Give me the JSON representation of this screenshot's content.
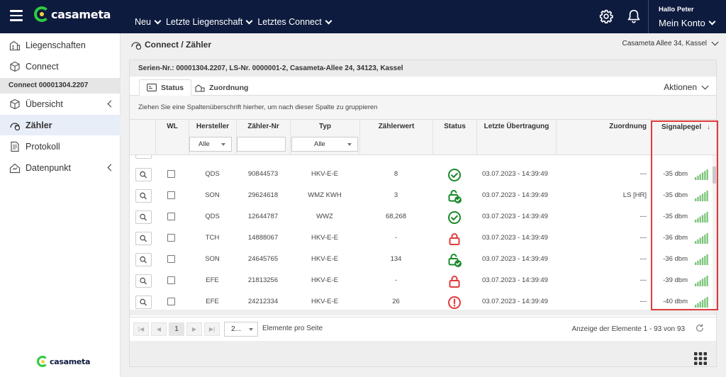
{
  "topbar": {
    "brand": "casameta",
    "nav": [
      {
        "label": "Neu"
      },
      {
        "label": "Letzte Liegenschaft"
      },
      {
        "label": "Letztes Connect"
      }
    ],
    "greeting": "Hallo Peter",
    "account_label": "Mein Konto"
  },
  "sidebar": {
    "items_top": [
      {
        "label": "Liegenschaften",
        "icon": "building-icon"
      },
      {
        "label": "Connect",
        "icon": "box-icon"
      }
    ],
    "section_label": "Connect 00001304.2207",
    "items_sub": [
      {
        "label": "Übersicht",
        "icon": "box-icon",
        "expandable": true
      },
      {
        "label": "Zähler",
        "icon": "meter-icon",
        "active": true
      },
      {
        "label": "Protokoll",
        "icon": "document-icon"
      },
      {
        "label": "Datenpunkt",
        "icon": "datapoint-icon",
        "expandable": true
      }
    ],
    "footer_brand": "casameta"
  },
  "main": {
    "title": "Connect / Zähler",
    "address": "Casameta Allee 34, Kassel",
    "card_header": "Serien-Nr.: 00001304.2207, LS-Nr. 0000001-2, Casameta-Allee 24, 34123, Kassel",
    "tabs": [
      {
        "label": "Status",
        "active": true
      },
      {
        "label": "Zuordnung",
        "active": false
      }
    ],
    "actions_label": "Aktionen",
    "group_hint": "Ziehen Sie eine Spaltenüberschrift hierher, um nach dieser Spalte zu gruppieren"
  },
  "grid": {
    "columns": {
      "wl": "WL",
      "hersteller": "Hersteller",
      "zaehler_nr": "Zähler-Nr",
      "typ": "Typ",
      "zaehlerwert": "Zählerwert",
      "status": "Status",
      "letzte_uebertragung": "Letzte Übertragung",
      "zuordnung": "Zuordnung",
      "signalpegel": "Signalpegel"
    },
    "sort_indicator": "↓",
    "filters": {
      "hersteller": "Alle",
      "typ": "Alle"
    },
    "rows": [
      {
        "hersteller": "QDS",
        "zaehler_nr": "90844573",
        "typ": "HKV-E-E",
        "wert": "8",
        "status": "ok",
        "zeit": "03.07.2023 - 14:39:49",
        "zuordnung": "---",
        "signal": "-35 dbm"
      },
      {
        "hersteller": "SON",
        "zaehler_nr": "29624618",
        "typ": "WMZ KWH",
        "wert": "3",
        "status": "unlocked",
        "zeit": "03.07.2023 - 14:39:49",
        "zuordnung": "LS [HR]",
        "signal": "-35 dbm"
      },
      {
        "hersteller": "QDS",
        "zaehler_nr": "12644787",
        "typ": "WWZ",
        "wert": "68,268",
        "status": "ok",
        "zeit": "03.07.2023 - 14:39:49",
        "zuordnung": "---",
        "signal": "-35 dbm"
      },
      {
        "hersteller": "TCH",
        "zaehler_nr": "14888067",
        "typ": "HKV-E-E",
        "wert": "-",
        "status": "locked",
        "zeit": "03.07.2023 - 14:39:49",
        "zuordnung": "---",
        "signal": "-36 dbm"
      },
      {
        "hersteller": "SON",
        "zaehler_nr": "24645765",
        "typ": "HKV-E-E",
        "wert": "134",
        "status": "unlocked",
        "zeit": "03.07.2023 - 14:39:49",
        "zuordnung": "---",
        "signal": "-36 dbm"
      },
      {
        "hersteller": "EFE",
        "zaehler_nr": "21813256",
        "typ": "HKV-E-E",
        "wert": "-",
        "status": "locked",
        "zeit": "03.07.2023 - 14:39:49",
        "zuordnung": "---",
        "signal": "-39 dbm"
      },
      {
        "hersteller": "EFE",
        "zaehler_nr": "24212334",
        "typ": "HKV-E-E",
        "wert": "26",
        "status": "error",
        "zeit": "03.07.2023 - 14:39:49",
        "zuordnung": "---",
        "signal": "-40 dbm"
      }
    ]
  },
  "pager": {
    "current_page": "1",
    "page_size": "2...",
    "page_size_label": "Elemente pro Seite",
    "info": "Anzeige der Elemente 1 - 93 von 93"
  },
  "colors": {
    "topbar_bg": "#0d1b3e",
    "status_green": "#1a8a2a",
    "status_red": "#e23b3b",
    "signal_green": "#7cc47a",
    "highlight": "#e23b3b"
  }
}
